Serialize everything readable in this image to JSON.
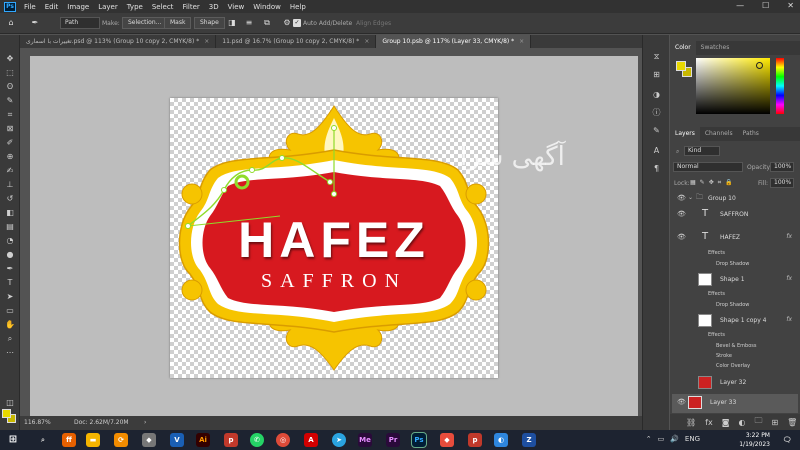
{
  "app": {
    "menu": [
      "File",
      "Edit",
      "Image",
      "Layer",
      "Type",
      "Select",
      "Filter",
      "3D",
      "View",
      "Window",
      "Help"
    ],
    "window_controls": [
      "—",
      "☐",
      "✕"
    ]
  },
  "options_bar": {
    "mode": "Path",
    "make_label": "Make:",
    "selection_btn": "Selection...",
    "mask_btn": "Mask",
    "shape_btn": "Shape",
    "auto_add_delete": "Auto Add/Delete",
    "align_edges": "Align Edges"
  },
  "tabs": [
    {
      "label": "تغییرات با اسماری.psd @ 113% (Group 10 copy 2, CMYK/8) *",
      "active": false
    },
    {
      "label": "11.psd @ 16.7% (Group 10 copy 2, CMYK/8) *",
      "active": false
    },
    {
      "label": "Group 10.psb @ 117% (Layer 33, CMYK/8) *",
      "active": true
    }
  ],
  "canvas": {
    "logo_title": "HAFEZ",
    "logo_subtitle": "SAFFRON",
    "watermark": "آگهی سرا",
    "colors": {
      "red": "#d7191f",
      "gold": "#f6c400",
      "white": "#ffffff"
    }
  },
  "status": {
    "zoom": "116.87%",
    "doc": "Doc: 2.62M/7.20M"
  },
  "color_panel": {
    "tabs": [
      "Color",
      "Swatches"
    ],
    "foreground": "#e8d800",
    "background": "#c8b800"
  },
  "layers_panel": {
    "tabs": [
      "Layers",
      "Channels",
      "Paths"
    ],
    "kind_filter": "Kind",
    "blend_mode": "Normal",
    "opacity_label": "Opacity:",
    "opacity_value": "100%",
    "lock_label": "Lock:",
    "fill_label": "Fill:",
    "fill_value": "100%",
    "group_name": "Group 10",
    "layers": [
      {
        "name": "SAFFRON",
        "type": "text"
      },
      {
        "name": "HAFEZ",
        "type": "text",
        "fx": "fx",
        "effects_label": "Effects",
        "effects": [
          "Drop Shadow"
        ]
      },
      {
        "name": "Shape 1",
        "type": "shape",
        "fx": "fx",
        "effects_label": "Effects",
        "effects": [
          "Drop Shadow"
        ]
      },
      {
        "name": "Shape 1 copy 4",
        "type": "shape",
        "fx": "fx",
        "effects_label": "Effects",
        "effects": [
          "Bevel & Emboss",
          "Stroke",
          "Color Overlay"
        ]
      },
      {
        "name": "Layer 32",
        "type": "image"
      },
      {
        "name": "Layer 33",
        "type": "image",
        "selected": true
      }
    ]
  },
  "taskbar": {
    "time": "3:22 PM",
    "date": "1/19/2023",
    "lang": "ENG"
  }
}
